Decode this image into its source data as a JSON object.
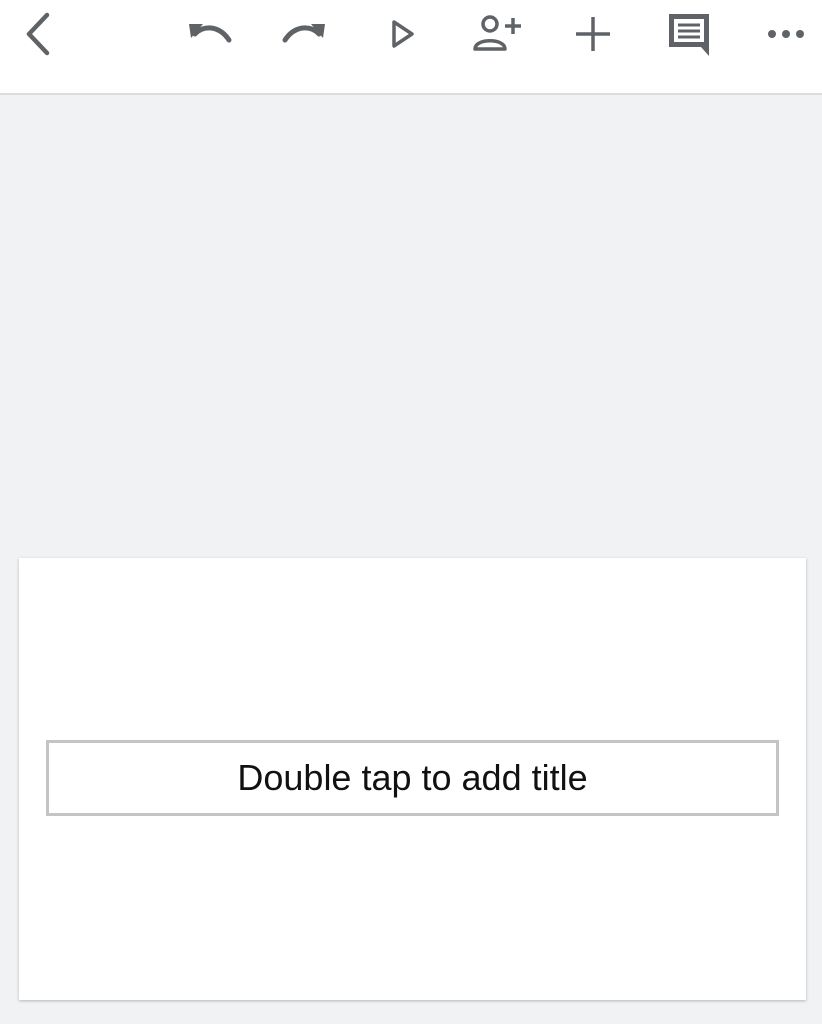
{
  "toolbar": {
    "icons": {
      "back": "back-arrow-icon",
      "undo": "undo-icon",
      "redo": "redo-icon",
      "present": "present-play-icon",
      "share": "add-person-icon",
      "insert": "plus-icon",
      "comment": "comment-icon",
      "more": "more-horizontal-icon"
    },
    "icon_color": "#5f6368"
  },
  "slide": {
    "title_placeholder": "Double tap to add title"
  },
  "colors": {
    "background": "#f1f2f4",
    "toolbar": "#ffffff",
    "slide": "#ffffff",
    "placeholder_border": "#c4c4c4"
  }
}
